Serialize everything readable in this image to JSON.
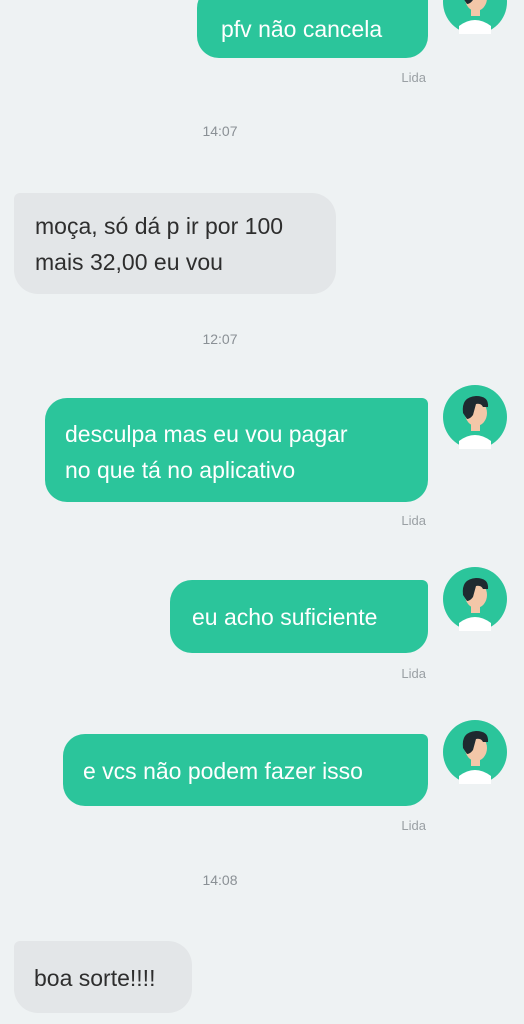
{
  "messages": [
    {
      "direction": "out",
      "lines": [
        "pfv não cancela"
      ],
      "status": "Lida"
    },
    {
      "time": "14:07"
    },
    {
      "direction": "in",
      "lines": [
        "moça, só dá p ir por 100",
        "mais 32,00 eu vou"
      ]
    },
    {
      "time": "12:07"
    },
    {
      "direction": "out",
      "lines": [
        "desculpa mas eu vou pagar",
        "no que tá no aplicativo"
      ],
      "status": "Lida"
    },
    {
      "direction": "out",
      "lines": [
        "eu acho suficiente"
      ],
      "status": "Lida"
    },
    {
      "direction": "out",
      "lines": [
        "e vcs não podem fazer isso"
      ],
      "status": "Lida"
    },
    {
      "time": "14:08"
    },
    {
      "direction": "in",
      "lines": [
        "boa sorte!!!!"
      ]
    }
  ],
  "colors": {
    "background": "#eef2f3",
    "outgoing_bubble": "#2bc59b",
    "incoming_bubble": "#e3e6e8",
    "avatar_bg": "#2bc59b",
    "avatar_hair": "#1f2a30",
    "avatar_skin": "#f3c7a8"
  },
  "icons": {
    "avatar": "male-driver-avatar-icon"
  }
}
